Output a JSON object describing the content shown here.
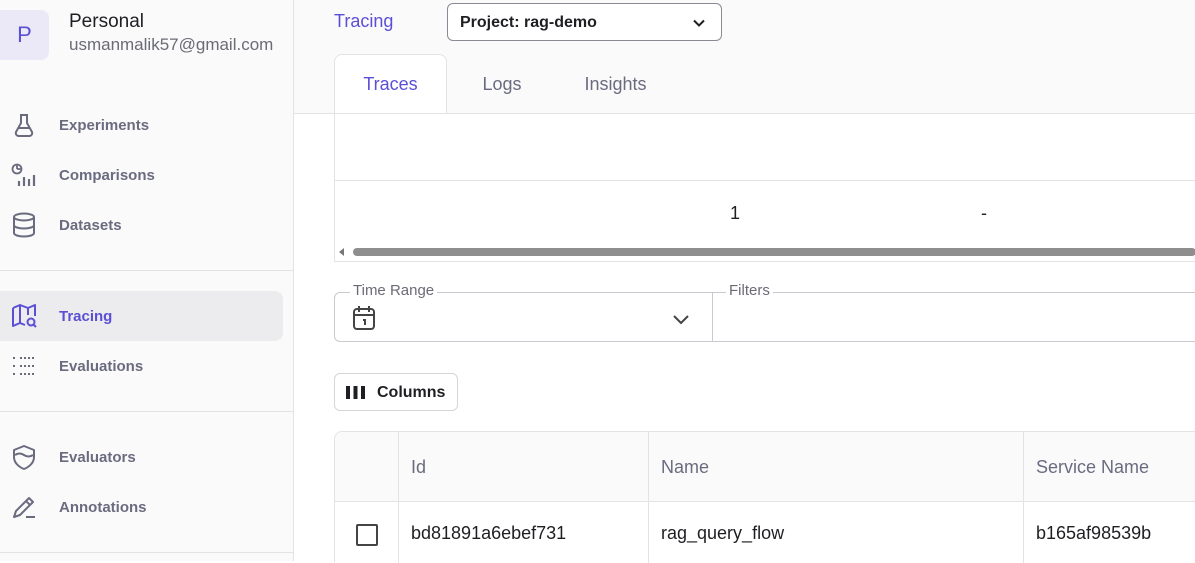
{
  "account": {
    "avatar_letter": "P",
    "name": "Personal",
    "email": "usmanmalik57@gmail.com"
  },
  "sidebar": {
    "items": [
      {
        "label": "Experiments",
        "icon": "flask-icon"
      },
      {
        "label": "Comparisons",
        "icon": "comparison-chart-icon"
      },
      {
        "label": "Datasets",
        "icon": "database-icon"
      },
      {
        "label": "Tracing",
        "icon": "map-search-icon",
        "active": true
      },
      {
        "label": "Evaluations",
        "icon": "list-icon"
      },
      {
        "label": "Evaluators",
        "icon": "shield-icon"
      },
      {
        "label": "Annotations",
        "icon": "pencil-icon"
      }
    ]
  },
  "header": {
    "breadcrumb": "Tracing",
    "project_select": "Project: rag-demo"
  },
  "tabs": [
    {
      "label": "Traces",
      "active": true
    },
    {
      "label": "Logs"
    },
    {
      "label": "Insights"
    }
  ],
  "stats": {
    "values": [
      "1",
      "-"
    ]
  },
  "filters": {
    "time_range_label": "Time Range",
    "filters_label": "Filters"
  },
  "toolbar": {
    "columns_label": "Columns"
  },
  "table": {
    "columns": [
      "Id",
      "Name",
      "Service Name"
    ],
    "rows": [
      {
        "id": "bd81891a6ebef731",
        "name": "rag_query_flow",
        "service_name": "b165af98539b"
      }
    ]
  },
  "colors": {
    "accent": "#5b4fd6",
    "sidebar_bg": "#fafafa",
    "border": "#e3e3e6"
  }
}
